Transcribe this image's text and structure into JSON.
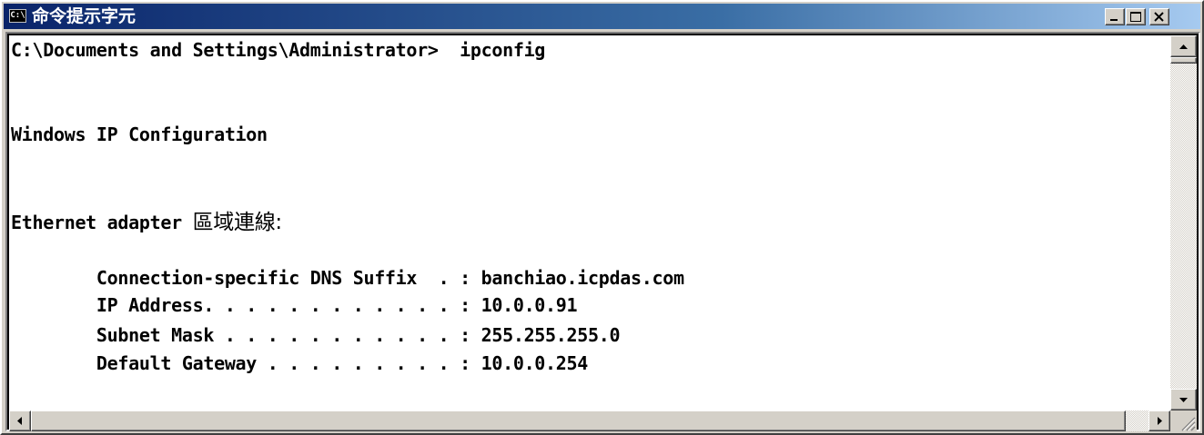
{
  "window": {
    "title": "命令提示字元",
    "icon": "C:\\",
    "controls": {
      "minimize": "minimize-icon",
      "maximize": "maximize-icon",
      "close": "close-icon"
    }
  },
  "console": {
    "lines": [
      "C:\\Documents and Settings\\Administrator>  ipconfig",
      "",
      "Windows IP Configuration",
      "",
      "",
      "Ethernet adapter ",
      "",
      "        Connection-specific DNS Suffix  . : banchiao.icpdas.com",
      "        IP Address. . . . . . . . . . . . : 10.0.0.91",
      "        Subnet Mask . . . . . . . . . . . : 255.255.255.0",
      "        Default Gateway . . . . . . . . . : 10.0.0.254"
    ],
    "adapter_name": "區域連線:"
  },
  "colors": {
    "title_start": "#0a246a",
    "title_end": "#a6caf0",
    "console_bg": "#ffffff",
    "console_fg": "#000000"
  }
}
